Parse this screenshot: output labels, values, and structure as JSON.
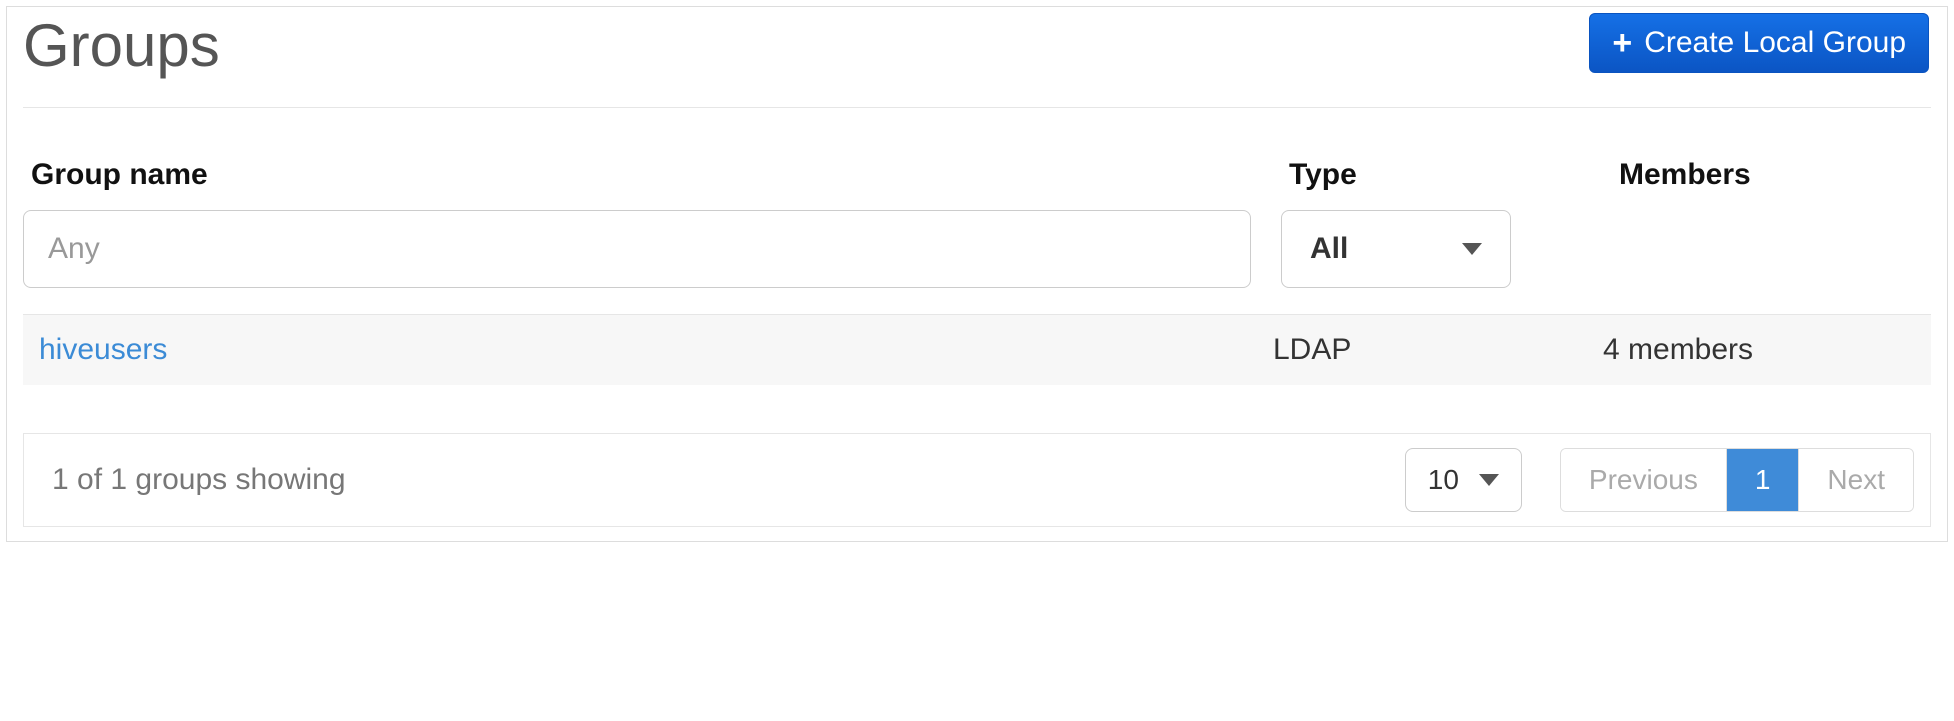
{
  "header": {
    "title": "Groups",
    "create_button_label": "Create Local Group"
  },
  "columns": {
    "group_name": "Group name",
    "type": "Type",
    "members": "Members"
  },
  "filters": {
    "name_placeholder": "Any",
    "type_selected": "All"
  },
  "rows": [
    {
      "name": "hiveusers",
      "type": "LDAP",
      "members": "4 members"
    }
  ],
  "footer": {
    "status": "1 of 1 groups showing",
    "page_size": "10",
    "prev_label": "Previous",
    "next_label": "Next",
    "current_page": "1"
  }
}
